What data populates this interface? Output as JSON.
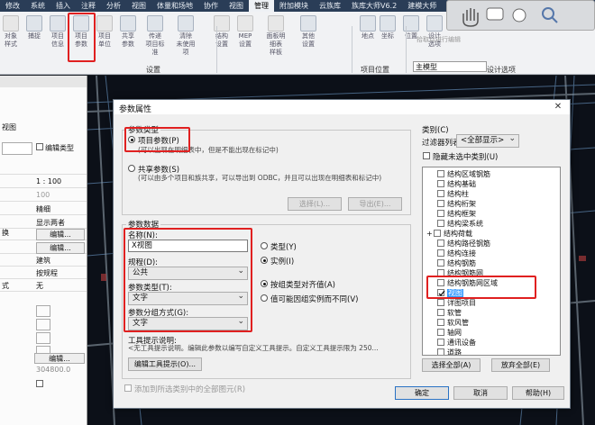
{
  "menubar": {
    "items": [
      "修改",
      "系统",
      "插入",
      "注释",
      "分析",
      "视图",
      "体量和场地",
      "协作",
      "视图",
      "管理",
      "附加模块",
      "云族库",
      "族库大师V6.2",
      "建模大师"
    ],
    "active_index": 9
  },
  "ribbon": {
    "buttons": [
      {
        "label": "对象\n样式"
      },
      {
        "label": "捕捉"
      },
      {
        "label": "项目\n信息"
      },
      {
        "label": "项目\n参数"
      },
      {
        "label": "项目\n单位"
      },
      {
        "label": "共享\n参数"
      },
      {
        "label": "传递\n项目标准"
      },
      {
        "label": "清除\n未使用项"
      },
      {
        "label": "结构\n设置"
      },
      {
        "label": "MEP\n设置"
      },
      {
        "label": "面板明细表\n样板"
      },
      {
        "label": "其他\n设置"
      },
      {
        "label": "地点"
      },
      {
        "label": "坐标"
      },
      {
        "label": "位置"
      },
      {
        "label": "设计\n选项"
      }
    ],
    "groups": {
      "settings": "设置",
      "project_location": "项目位置",
      "design_options": "设计选项"
    },
    "pickup_design": "拾取以进行编辑",
    "main_model": "主模型"
  },
  "left_panel": {
    "edit_type_label": "编辑类型",
    "rows": [
      {
        "label": "",
        "value": ""
      },
      {
        "label": "",
        "value": "1 : 100"
      },
      {
        "label": "",
        "value": "100"
      },
      {
        "label": "",
        "value": "精细"
      },
      {
        "label": "",
        "value": "显示两者"
      },
      {
        "label": "",
        "value": "编辑..."
      },
      {
        "label": "",
        "value": "编辑..."
      },
      {
        "label": "",
        "value": "建筑"
      },
      {
        "label": "",
        "value": "按规程"
      },
      {
        "label": "",
        "value": "无"
      }
    ],
    "partial_labels": [
      "视图",
      "换",
      "式"
    ],
    "bottom_values": [
      "编辑...",
      "304800.0"
    ]
  },
  "dialog": {
    "title": "参数属性",
    "close_glyph": "✕",
    "param_type": {
      "heading": "参数类型",
      "project_param": "项目参数(P)",
      "project_param_desc": "(可以出现在明细表中，但是不能出现在标记中)",
      "shared_param": "共享参数(S)",
      "shared_param_desc": "(可以由多个项目和族共享，可以导出到 ODBC，并且可以出现在明细表和标记中)",
      "select_btn": "选择(L)...",
      "export_btn": "导出(E)..."
    },
    "param_data": {
      "heading": "参数数据",
      "name_label": "名称(N):",
      "name_value": "X视图",
      "discipline_label": "规程(D):",
      "discipline_value": "公共",
      "param_type_label": "参数类型(T):",
      "param_type_value": "文字",
      "group_label": "参数分组方式(G):",
      "group_value": "文字",
      "type_radio": "类型(Y)",
      "instance_radio": "实例(I)",
      "align_by_group": "按组类型对齐值(A)",
      "vary_by_group": "值可能因组实例而不同(V)",
      "tooltip_heading": "工具提示说明:",
      "tooltip_text": "<无工具提示说明。编辑此参数以编写自定义工具提示。自定义工具提示限为 250...",
      "edit_tooltip_btn": "编辑工具提示(O)...",
      "add_to_all": "添加到所选类别中的全部图元(R)"
    },
    "category": {
      "heading": "类别(C)",
      "filter_label": "过滤器列表:",
      "filter_value": "<全部显示>",
      "hide_unchecked": "隐藏未选中类别(U)",
      "items": [
        {
          "label": "结构区域钢筋",
          "checked": false,
          "indent": 2
        },
        {
          "label": "结构基础",
          "checked": false,
          "indent": 2
        },
        {
          "label": "结构柱",
          "checked": false,
          "indent": 2
        },
        {
          "label": "结构桁架",
          "checked": false,
          "indent": 2
        },
        {
          "label": "结构框架",
          "checked": false,
          "indent": 2
        },
        {
          "label": "结构梁系统",
          "checked": false,
          "indent": 2
        },
        {
          "label": "结构荷载",
          "checked": false,
          "indent": 1,
          "expander": "+"
        },
        {
          "label": "结构路径钢筋",
          "checked": false,
          "indent": 2
        },
        {
          "label": "结构连接",
          "checked": false,
          "indent": 2
        },
        {
          "label": "结构钢筋",
          "checked": false,
          "indent": 2
        },
        {
          "label": "结构钢筋网",
          "checked": false,
          "indent": 2
        },
        {
          "label": "结构钢筋网区域",
          "checked": false,
          "indent": 2
        },
        {
          "label": "视图",
          "checked": true,
          "indent": 2,
          "selected": true
        },
        {
          "label": "详图项目",
          "checked": false,
          "indent": 2
        },
        {
          "label": "软管",
          "checked": false,
          "indent": 2
        },
        {
          "label": "软风管",
          "checked": false,
          "indent": 2
        },
        {
          "label": "轴网",
          "checked": false,
          "indent": 2
        },
        {
          "label": "通讯设备",
          "checked": false,
          "indent": 2
        },
        {
          "label": "道路",
          "checked": false,
          "indent": 2
        }
      ],
      "select_all": "选择全部(A)",
      "deselect_all": "放弃全部(E)"
    },
    "ok": "确定",
    "cancel": "取消",
    "help": "帮助(H)"
  },
  "colors": {
    "highlight": "#e02020",
    "menubar": "#2a3d57",
    "selection": "#3399ff"
  }
}
